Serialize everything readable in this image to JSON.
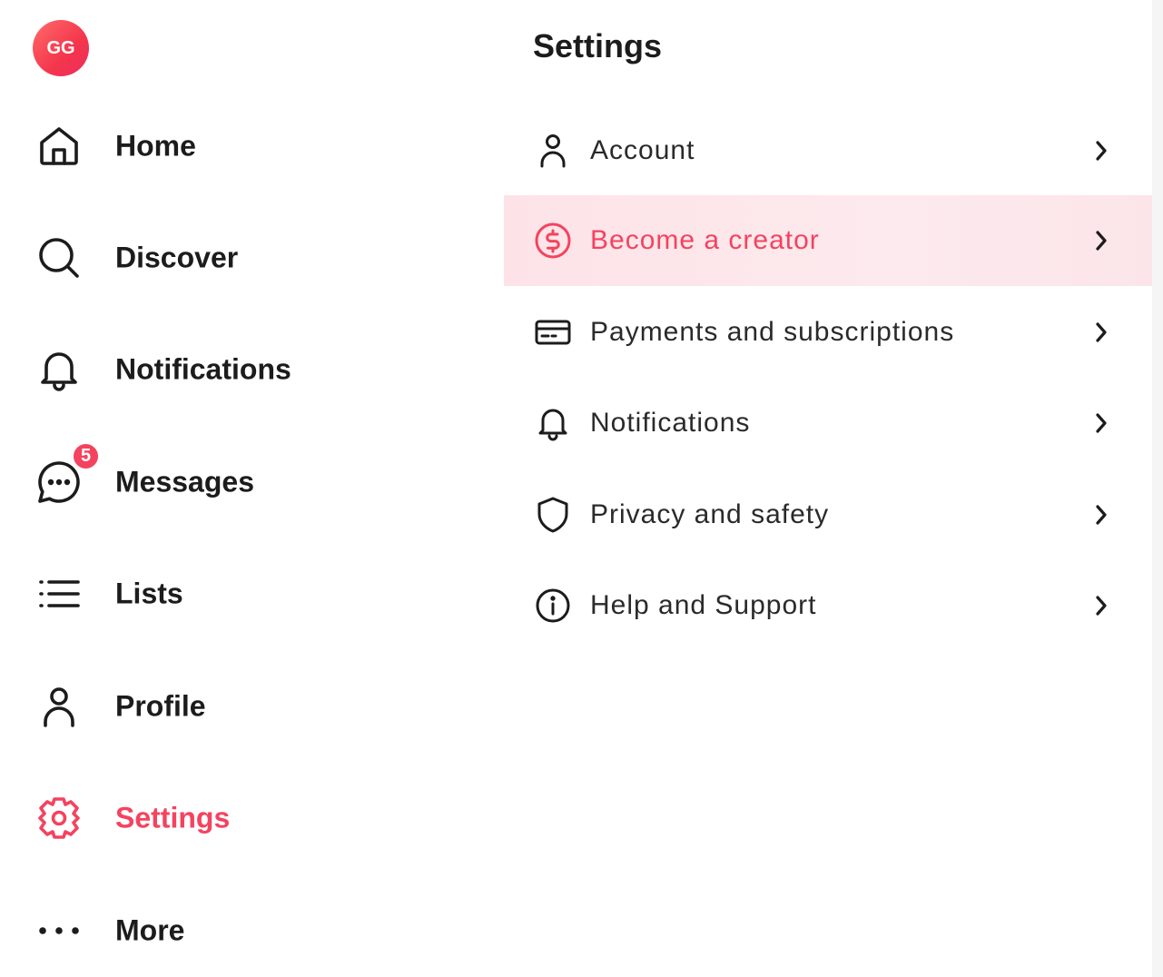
{
  "user": {
    "avatar_initials": "GG"
  },
  "nav": {
    "items": [
      {
        "label": "Home",
        "icon": "home-icon"
      },
      {
        "label": "Discover",
        "icon": "search-icon"
      },
      {
        "label": "Notifications",
        "icon": "bell-icon"
      },
      {
        "label": "Messages",
        "icon": "chat-icon",
        "badge": "5"
      },
      {
        "label": "Lists",
        "icon": "list-icon"
      },
      {
        "label": "Profile",
        "icon": "person-icon"
      },
      {
        "label": "Settings",
        "icon": "gear-icon",
        "active": true
      },
      {
        "label": "More",
        "icon": "more-dots-icon"
      }
    ]
  },
  "settings": {
    "title": "Settings",
    "rows": [
      {
        "label": "Account",
        "icon": "person-icon"
      },
      {
        "label": "Become a creator",
        "icon": "dollar-circle-icon",
        "highlighted": true
      },
      {
        "label": "Payments and subscriptions",
        "icon": "card-icon"
      },
      {
        "label": "Notifications",
        "icon": "bell-icon"
      },
      {
        "label": "Privacy and safety",
        "icon": "shield-icon"
      },
      {
        "label": "Help and Support",
        "icon": "info-icon"
      }
    ]
  },
  "colors": {
    "accent": "#f4435f",
    "text": "#1c1c1c",
    "highlight_bg": "#fde3e7"
  }
}
